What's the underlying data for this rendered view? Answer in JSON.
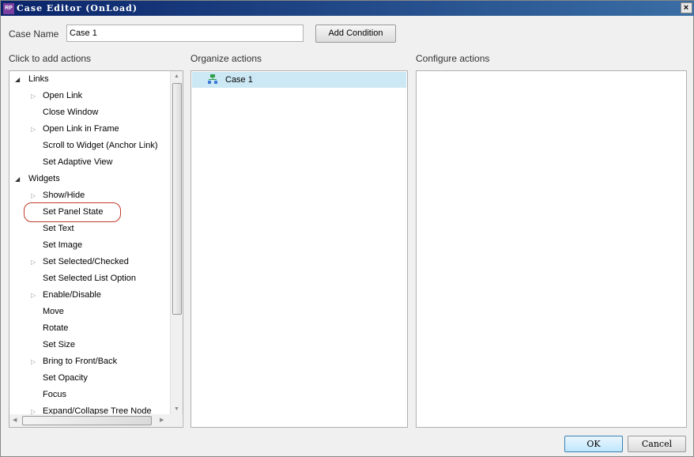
{
  "window": {
    "title": "Case Editor (OnLoad)",
    "app_icon": "RP",
    "close": "×"
  },
  "case_name": {
    "label": "Case Name",
    "value": "Case 1"
  },
  "add_condition": "Add Condition",
  "sections": {
    "add": "Click to add actions",
    "organize": "Organize actions",
    "configure": "Configure actions"
  },
  "tree": [
    {
      "label": "Links",
      "type": "group"
    },
    {
      "label": "Open Link",
      "expandable": true
    },
    {
      "label": "Close Window",
      "expandable": false
    },
    {
      "label": "Open Link in Frame",
      "expandable": true
    },
    {
      "label": "Scroll to Widget (Anchor Link)",
      "expandable": false
    },
    {
      "label": "Set Adaptive View",
      "expandable": false
    },
    {
      "label": "Widgets",
      "type": "group"
    },
    {
      "label": "Show/Hide",
      "expandable": true
    },
    {
      "label": "Set Panel State",
      "expandable": false,
      "highlighted": true
    },
    {
      "label": "Set Text",
      "expandable": false
    },
    {
      "label": "Set Image",
      "expandable": false
    },
    {
      "label": "Set Selected/Checked",
      "expandable": true
    },
    {
      "label": "Set Selected List Option",
      "expandable": false
    },
    {
      "label": "Enable/Disable",
      "expandable": true
    },
    {
      "label": "Move",
      "expandable": false
    },
    {
      "label": "Rotate",
      "expandable": false
    },
    {
      "label": "Set Size",
      "expandable": false
    },
    {
      "label": "Bring to Front/Back",
      "expandable": true
    },
    {
      "label": "Set Opacity",
      "expandable": false
    },
    {
      "label": "Focus",
      "expandable": false
    },
    {
      "label": "Expand/Collapse Tree Node",
      "expandable": true
    }
  ],
  "organize": {
    "case_label": "Case 1",
    "selected_bg": "#cce8f4"
  },
  "buttons": {
    "ok": "OK",
    "cancel": "Cancel"
  },
  "colors": {
    "highlight_circle": "#c0392b",
    "case_icon": "#2e9e4a"
  }
}
